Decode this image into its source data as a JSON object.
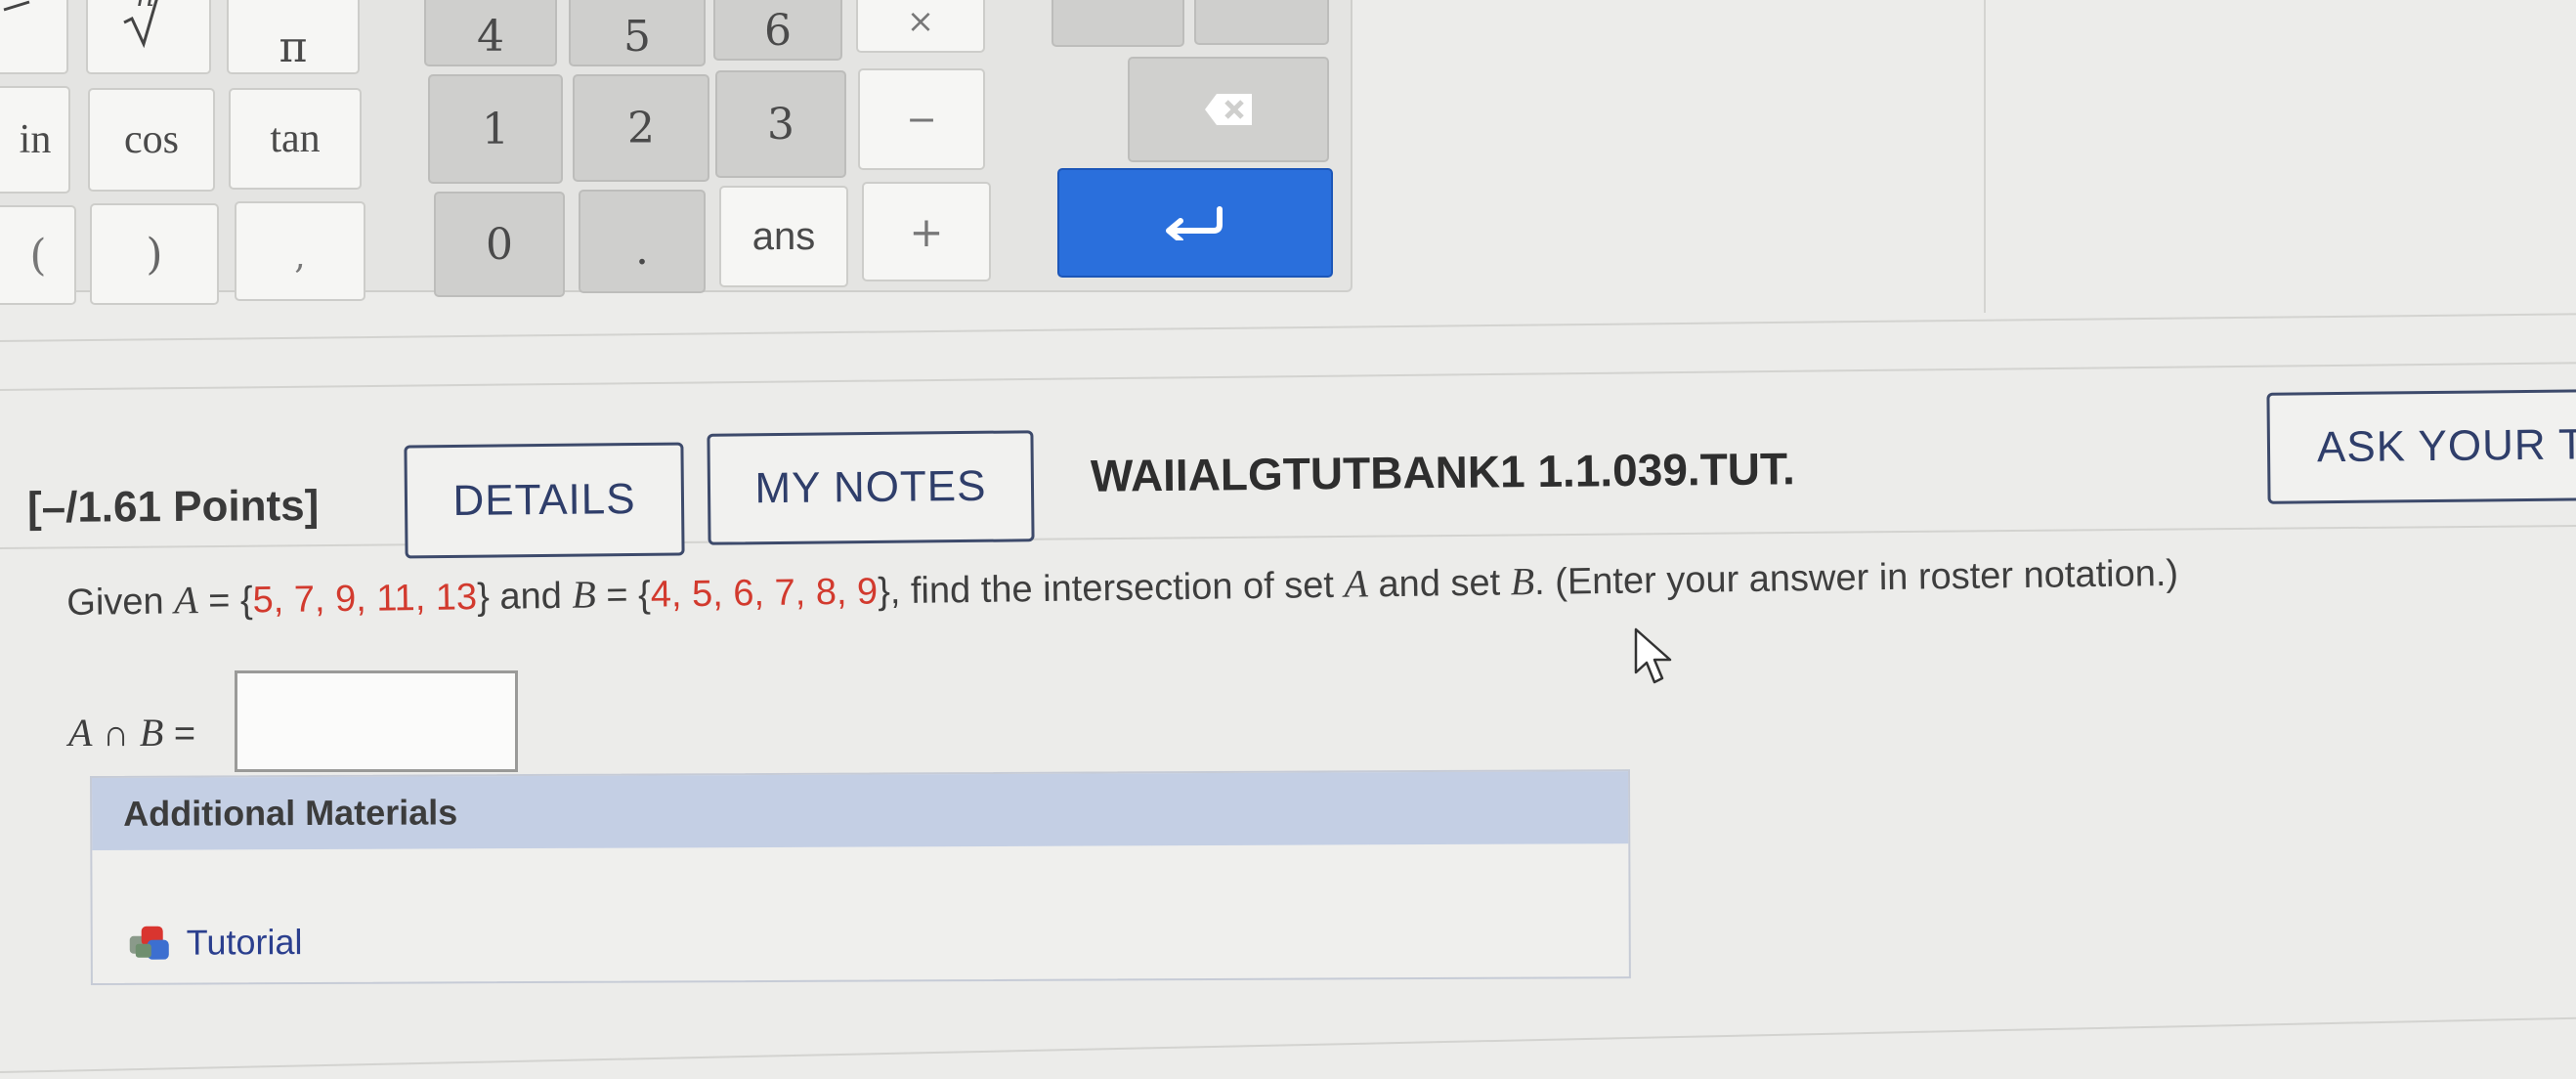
{
  "calculator": {
    "row1": {
      "nth_root_sup": "n",
      "pi": "π",
      "k4": "4",
      "k5": "5",
      "k6": "6",
      "times": "×"
    },
    "row2": {
      "sin": "in",
      "cos": "cos",
      "tan": "tan",
      "k1": "1",
      "k2": "2",
      "k3": "3",
      "minus": "−"
    },
    "row3": {
      "lparen": "(",
      "rparen": ")",
      "comma": ",",
      "k0": "0",
      "dot": ".",
      "ans": "ans",
      "plus": "+"
    }
  },
  "question": {
    "points": "[–/1.61 Points]",
    "details_label": "DETAILS",
    "my_notes_label": "MY NOTES",
    "id": "WAIIALGTUTBANK1 1.1.039.TUT.",
    "ask_label": "ASK YOUR T",
    "text": {
      "given": "Given ",
      "a_var": "A",
      "eq1": " = {",
      "a_values": "5, 7, 9, 11, 13",
      "close_and": "} and ",
      "b_var": "B",
      "eq2": " = {",
      "b_values": "4, 5, 6, 7, 8, 9",
      "rest1": "}, find the intersection of set ",
      "a_var2": "A",
      "rest2": " and set ",
      "b_var2": "B",
      "rest3": ". (Enter your answer in roster notation.)"
    },
    "answer_label": {
      "a": "A",
      "cap": " ∩ ",
      "b": "B",
      "eq": " ="
    },
    "answer_value": ""
  },
  "materials": {
    "header": "Additional Materials",
    "tutorial_label": "Tutorial"
  },
  "colors": {
    "accent_blue": "#2a6fdc",
    "value_red": "#d23a2e",
    "materials_header": "#c4cfe4"
  }
}
